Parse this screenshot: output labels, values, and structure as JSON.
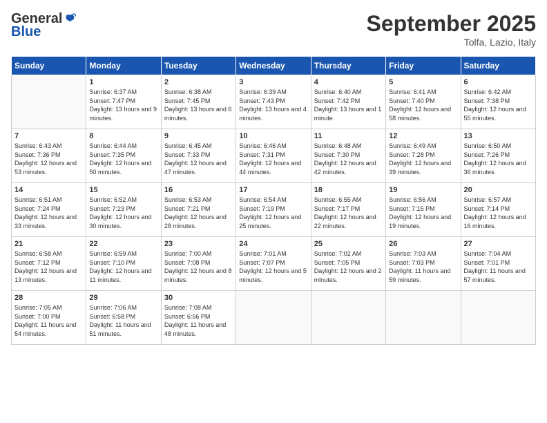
{
  "header": {
    "logo_general": "General",
    "logo_blue": "Blue",
    "month_title": "September 2025",
    "location": "Tolfa, Lazio, Italy"
  },
  "weekdays": [
    "Sunday",
    "Monday",
    "Tuesday",
    "Wednesday",
    "Thursday",
    "Friday",
    "Saturday"
  ],
  "weeks": [
    [
      {
        "day": "",
        "empty": true
      },
      {
        "day": "1",
        "sunrise": "Sunrise: 6:37 AM",
        "sunset": "Sunset: 7:47 PM",
        "daylight": "Daylight: 13 hours and 9 minutes."
      },
      {
        "day": "2",
        "sunrise": "Sunrise: 6:38 AM",
        "sunset": "Sunset: 7:45 PM",
        "daylight": "Daylight: 13 hours and 6 minutes."
      },
      {
        "day": "3",
        "sunrise": "Sunrise: 6:39 AM",
        "sunset": "Sunset: 7:43 PM",
        "daylight": "Daylight: 13 hours and 4 minutes."
      },
      {
        "day": "4",
        "sunrise": "Sunrise: 6:40 AM",
        "sunset": "Sunset: 7:42 PM",
        "daylight": "Daylight: 13 hours and 1 minute."
      },
      {
        "day": "5",
        "sunrise": "Sunrise: 6:41 AM",
        "sunset": "Sunset: 7:40 PM",
        "daylight": "Daylight: 12 hours and 58 minutes."
      },
      {
        "day": "6",
        "sunrise": "Sunrise: 6:42 AM",
        "sunset": "Sunset: 7:38 PM",
        "daylight": "Daylight: 12 hours and 55 minutes."
      }
    ],
    [
      {
        "day": "7",
        "sunrise": "Sunrise: 6:43 AM",
        "sunset": "Sunset: 7:36 PM",
        "daylight": "Daylight: 12 hours and 53 minutes."
      },
      {
        "day": "8",
        "sunrise": "Sunrise: 6:44 AM",
        "sunset": "Sunset: 7:35 PM",
        "daylight": "Daylight: 12 hours and 50 minutes."
      },
      {
        "day": "9",
        "sunrise": "Sunrise: 6:45 AM",
        "sunset": "Sunset: 7:33 PM",
        "daylight": "Daylight: 12 hours and 47 minutes."
      },
      {
        "day": "10",
        "sunrise": "Sunrise: 6:46 AM",
        "sunset": "Sunset: 7:31 PM",
        "daylight": "Daylight: 12 hours and 44 minutes."
      },
      {
        "day": "11",
        "sunrise": "Sunrise: 6:48 AM",
        "sunset": "Sunset: 7:30 PM",
        "daylight": "Daylight: 12 hours and 42 minutes."
      },
      {
        "day": "12",
        "sunrise": "Sunrise: 6:49 AM",
        "sunset": "Sunset: 7:28 PM",
        "daylight": "Daylight: 12 hours and 39 minutes."
      },
      {
        "day": "13",
        "sunrise": "Sunrise: 6:50 AM",
        "sunset": "Sunset: 7:26 PM",
        "daylight": "Daylight: 12 hours and 36 minutes."
      }
    ],
    [
      {
        "day": "14",
        "sunrise": "Sunrise: 6:51 AM",
        "sunset": "Sunset: 7:24 PM",
        "daylight": "Daylight: 12 hours and 33 minutes."
      },
      {
        "day": "15",
        "sunrise": "Sunrise: 6:52 AM",
        "sunset": "Sunset: 7:23 PM",
        "daylight": "Daylight: 12 hours and 30 minutes."
      },
      {
        "day": "16",
        "sunrise": "Sunrise: 6:53 AM",
        "sunset": "Sunset: 7:21 PM",
        "daylight": "Daylight: 12 hours and 28 minutes."
      },
      {
        "day": "17",
        "sunrise": "Sunrise: 6:54 AM",
        "sunset": "Sunset: 7:19 PM",
        "daylight": "Daylight: 12 hours and 25 minutes."
      },
      {
        "day": "18",
        "sunrise": "Sunrise: 6:55 AM",
        "sunset": "Sunset: 7:17 PM",
        "daylight": "Daylight: 12 hours and 22 minutes."
      },
      {
        "day": "19",
        "sunrise": "Sunrise: 6:56 AM",
        "sunset": "Sunset: 7:15 PM",
        "daylight": "Daylight: 12 hours and 19 minutes."
      },
      {
        "day": "20",
        "sunrise": "Sunrise: 6:57 AM",
        "sunset": "Sunset: 7:14 PM",
        "daylight": "Daylight: 12 hours and 16 minutes."
      }
    ],
    [
      {
        "day": "21",
        "sunrise": "Sunrise: 6:58 AM",
        "sunset": "Sunset: 7:12 PM",
        "daylight": "Daylight: 12 hours and 13 minutes."
      },
      {
        "day": "22",
        "sunrise": "Sunrise: 6:59 AM",
        "sunset": "Sunset: 7:10 PM",
        "daylight": "Daylight: 12 hours and 11 minutes."
      },
      {
        "day": "23",
        "sunrise": "Sunrise: 7:00 AM",
        "sunset": "Sunset: 7:08 PM",
        "daylight": "Daylight: 12 hours and 8 minutes."
      },
      {
        "day": "24",
        "sunrise": "Sunrise: 7:01 AM",
        "sunset": "Sunset: 7:07 PM",
        "daylight": "Daylight: 12 hours and 5 minutes."
      },
      {
        "day": "25",
        "sunrise": "Sunrise: 7:02 AM",
        "sunset": "Sunset: 7:05 PM",
        "daylight": "Daylight: 12 hours and 2 minutes."
      },
      {
        "day": "26",
        "sunrise": "Sunrise: 7:03 AM",
        "sunset": "Sunset: 7:03 PM",
        "daylight": "Daylight: 11 hours and 59 minutes."
      },
      {
        "day": "27",
        "sunrise": "Sunrise: 7:04 AM",
        "sunset": "Sunset: 7:01 PM",
        "daylight": "Daylight: 11 hours and 57 minutes."
      }
    ],
    [
      {
        "day": "28",
        "sunrise": "Sunrise: 7:05 AM",
        "sunset": "Sunset: 7:00 PM",
        "daylight": "Daylight: 11 hours and 54 minutes."
      },
      {
        "day": "29",
        "sunrise": "Sunrise: 7:06 AM",
        "sunset": "Sunset: 6:58 PM",
        "daylight": "Daylight: 11 hours and 51 minutes."
      },
      {
        "day": "30",
        "sunrise": "Sunrise: 7:08 AM",
        "sunset": "Sunset: 6:56 PM",
        "daylight": "Daylight: 11 hours and 48 minutes."
      },
      {
        "day": "",
        "empty": true
      },
      {
        "day": "",
        "empty": true
      },
      {
        "day": "",
        "empty": true
      },
      {
        "day": "",
        "empty": true
      }
    ]
  ]
}
